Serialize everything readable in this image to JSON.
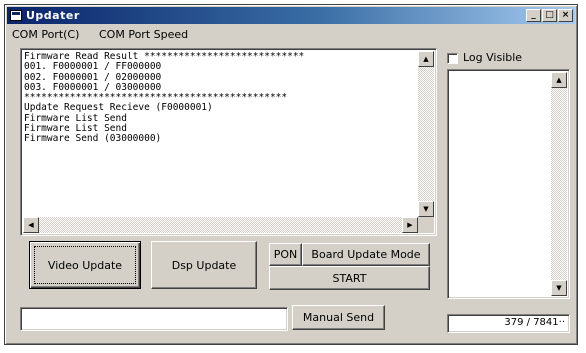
{
  "window": {
    "title": "Updater"
  },
  "menu": [
    {
      "label": "COM Port(C)"
    },
    {
      "label": "COM Port Speed"
    }
  ],
  "log": {
    "lines": [
      "Firmware Read Result ****************************",
      "001. F0000001 / FF000000",
      "002. F0000001 / 02000000",
      "003. F0000001 / 03000000",
      "**********************************************",
      "Update Request Recieve (F0000001)",
      "Firmware List Send",
      "Firmware List Send",
      "Firmware Send (03000000)"
    ]
  },
  "buttons": {
    "video_update": "Video Update",
    "dsp_update": "Dsp Update",
    "pon": "PON",
    "board_update_mode": "Board Update Mode",
    "start": "START",
    "manual_send": "Manual Send"
  },
  "log_visible": {
    "label": "Log Visible",
    "checked": false
  },
  "send_input": {
    "value": ""
  },
  "status": {
    "progress_text": "379 / 7841··"
  },
  "colors": {
    "title_active": "#0a246a",
    "title_gradient_end": "#a6caf0",
    "face": "#d4d0c8"
  }
}
